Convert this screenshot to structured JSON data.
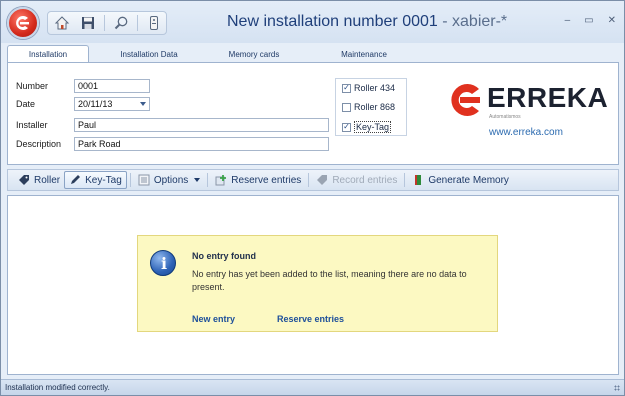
{
  "window": {
    "title": "New installation number 0001",
    "title_suffix": " - xabier-*"
  },
  "tabs": [
    {
      "label": "Installation",
      "active": true
    },
    {
      "label": "Installation Data",
      "active": false
    },
    {
      "label": "Memory cards",
      "active": false
    },
    {
      "label": "Maintenance",
      "active": false
    }
  ],
  "form": {
    "number_label": "Number",
    "number_value": "0001",
    "date_label": "Date",
    "date_value": "20/11/13",
    "installer_label": "Installer",
    "installer_value": "Paul",
    "description_label": "Description",
    "description_value": "Park Road"
  },
  "options": [
    {
      "label": "Roller 434",
      "checked": true
    },
    {
      "label": "Roller 868",
      "checked": false
    },
    {
      "label": "Key-Tag",
      "checked": true
    }
  ],
  "brand": {
    "name": "ERREKA",
    "tagline": "Automatismos",
    "url": "www.erreka.com",
    "color": "#e0311f"
  },
  "toolbar": {
    "roller": "Roller",
    "key_tag": "Key-Tag",
    "options": "Options",
    "reserve_entries": "Reserve entries",
    "record_entries": "Record entries",
    "generate_memory": "Generate Memory"
  },
  "notice": {
    "title": "No entry found",
    "text": "No entry has yet been added to the list, meaning there are no data to present.",
    "new_entry": "New entry",
    "reserve_entries": "Reserve entries"
  },
  "status": {
    "text": "Installation modified correctly."
  }
}
